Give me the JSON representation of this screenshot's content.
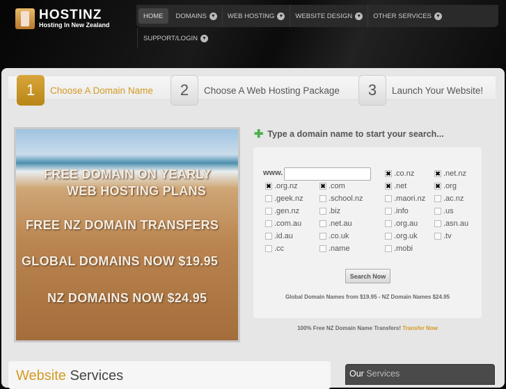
{
  "logo": {
    "name": "HOSTINZ",
    "tagline": "Hosting In New Zealand"
  },
  "nav": {
    "items": [
      "HOME",
      "DOMAINS",
      "WEB HOSTING",
      "WEBSITE DESIGN",
      "OTHER SERVICES"
    ],
    "second_row": "SUPPORT/LOGIN"
  },
  "steps": [
    {
      "num": "1",
      "label": "Choose A Domain Name"
    },
    {
      "num": "2",
      "label": "Choose A Web Hosting Package"
    },
    {
      "num": "3",
      "label": "Launch Your Website!"
    }
  ],
  "banner": {
    "lines": [
      "FREE DOMAIN ON YEARLY",
      "WEB HOSTING PLANS",
      "FREE NZ DOMAIN TRANSFERS",
      "GLOBAL DOMAINS NOW $19.95",
      "NZ DOMAINS NOW $24.95"
    ]
  },
  "search": {
    "title": "Type a domain name to start your search...",
    "www_label": "www.",
    "input_value": "",
    "button": "Search Now",
    "tlds": [
      {
        "label": ".co.nz",
        "checked": true
      },
      {
        "label": ".net.nz",
        "checked": true
      },
      {
        "label": ".org.nz",
        "checked": true
      },
      {
        "label": ".com",
        "checked": true
      },
      {
        "label": ".net",
        "checked": true
      },
      {
        "label": ".org",
        "checked": true
      },
      {
        "label": ".geek.nz",
        "checked": false
      },
      {
        "label": ".school.nz",
        "checked": false
      },
      {
        "label": ".maori.nz",
        "checked": false
      },
      {
        "label": ".ac.nz",
        "checked": false
      },
      {
        "label": ".gen.nz",
        "checked": false
      },
      {
        "label": ".biz",
        "checked": false
      },
      {
        "label": ".info",
        "checked": false
      },
      {
        "label": ".us",
        "checked": false
      },
      {
        "label": ".com.au",
        "checked": false
      },
      {
        "label": ".net.au",
        "checked": false
      },
      {
        "label": ".org.au",
        "checked": false
      },
      {
        "label": ".asn.au",
        "checked": false
      },
      {
        "label": ".id.au",
        "checked": false
      },
      {
        "label": ".co.uk",
        "checked": false
      },
      {
        "label": ".org.uk",
        "checked": false
      },
      {
        "label": ".tv",
        "checked": false
      },
      {
        "label": ".cc",
        "checked": false
      },
      {
        "label": ".name",
        "checked": false
      },
      {
        "label": ".mobi",
        "checked": false
      }
    ],
    "pricing": "Global Domain Names from $19.95 - NZ Domain Names $24.95",
    "transfer_text": "100% Free NZ Domain Name Transfers!",
    "transfer_link": "Transfer Now"
  },
  "website_services": {
    "highlight": "Website",
    "rest": "Services"
  },
  "our_services": {
    "first": "Our",
    "second": "Services"
  }
}
